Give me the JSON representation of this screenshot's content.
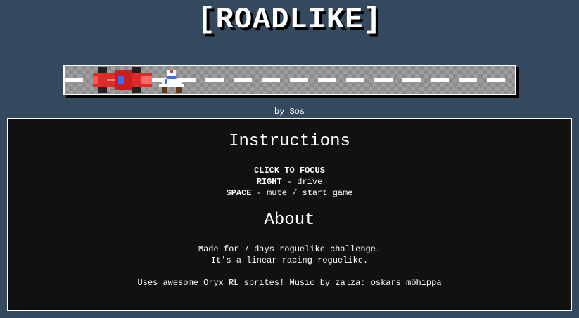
{
  "header": {
    "title": "[ROADLIKE]",
    "byline": "by Sos"
  },
  "instructions": {
    "heading": "Instructions",
    "lines": [
      {
        "key": "CLICK TO FOCUS",
        "text": ""
      },
      {
        "key": "RIGHT",
        "text": " - drive"
      },
      {
        "key": "SPACE",
        "text": " - mute / start game"
      }
    ]
  },
  "about": {
    "heading": "About",
    "lines": [
      "Made for 7 days roguelike challenge.",
      "It's a linear racing roguelike.",
      "Uses awesome Oryx RL sprites! Music by zalza: oskars möhippa"
    ]
  },
  "colors": {
    "background": "#34495e",
    "panel": "#111111",
    "road": "#8c8c8c",
    "car": "#e02020"
  },
  "icons": {
    "car": "red-race-car-sprite",
    "driver": "driver-sprite"
  }
}
